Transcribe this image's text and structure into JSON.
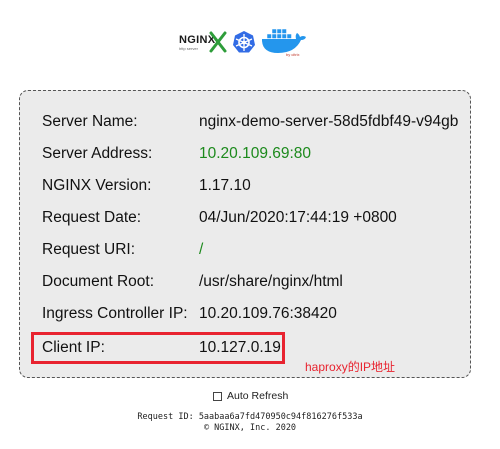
{
  "header": {
    "nginx_logo_text": "NGINX",
    "nginx_logo_subtext": "http server",
    "docker_logo_subtext": "by citrix"
  },
  "server_info": [
    {
      "label": "Server Name:",
      "value": "nginx-demo-server-58d5fdbf49-v94gb",
      "color": "#111111"
    },
    {
      "label": "Server Address:",
      "value": "10.20.109.69:80",
      "color": "#1c8a1c"
    },
    {
      "label": "NGINX Version:",
      "value": "1.17.10",
      "color": "#111111"
    },
    {
      "label": "Request Date:",
      "value": "04/Jun/2020:17:44:19 +0800",
      "color": "#111111"
    },
    {
      "label": "Request URI:",
      "value": "/",
      "color": "#1c8a1c"
    },
    {
      "label": "Document Root:",
      "value": "/usr/share/nginx/html",
      "color": "#111111"
    },
    {
      "label": "Ingress Controller IP:",
      "value": "10.20.109.76:38420",
      "color": "#111111"
    },
    {
      "label": "Client IP:",
      "value": "10.127.0.19",
      "color": "#111111"
    }
  ],
  "annotation": {
    "text": "haproxy的IP地址",
    "color": "#e8232f"
  },
  "auto_refresh": {
    "label": "Auto Refresh",
    "checked": false
  },
  "footer": {
    "request_id": "Request ID: 5aabaa6a7fd470950c94f816276f533a",
    "copyright": "© NGINX, Inc. 2020"
  }
}
